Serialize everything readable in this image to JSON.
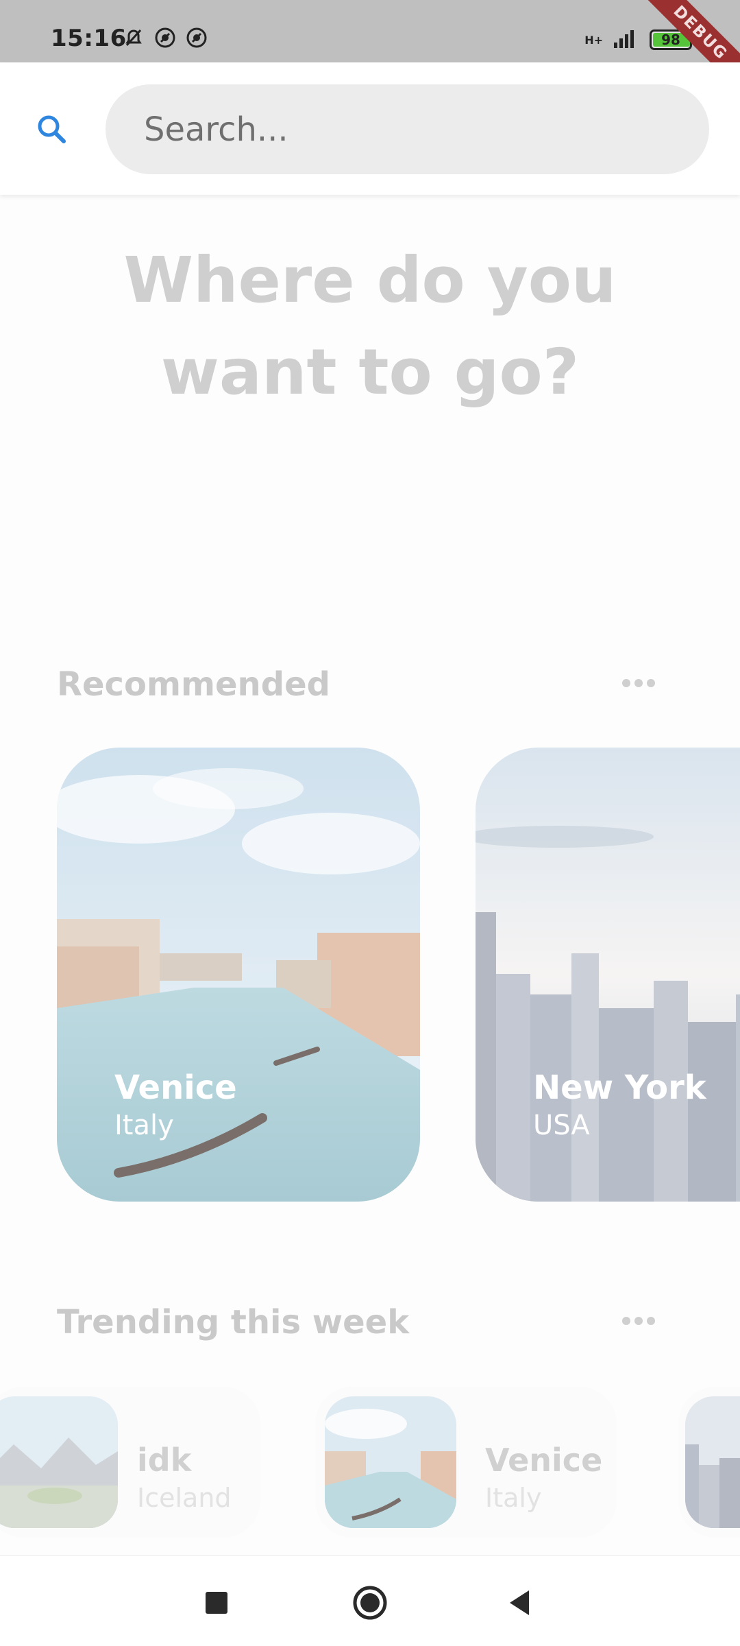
{
  "status_bar": {
    "time": "15:16",
    "network": "H+",
    "battery": "98",
    "debug_banner": "DEBUG"
  },
  "search": {
    "placeholder": "Search...",
    "value": ""
  },
  "headline": {
    "line1": "Where do you",
    "line2": "want to go?"
  },
  "recommended": {
    "title": "Recommended",
    "items": [
      {
        "name": "Venice",
        "country": "Italy"
      },
      {
        "name": "New York",
        "country": "USA"
      }
    ]
  },
  "trending": {
    "title": "Trending this week",
    "items": [
      {
        "name": "idk",
        "country": "Iceland"
      },
      {
        "name": "Venice",
        "country": "Italy"
      },
      {
        "name": "",
        "country": ""
      }
    ]
  },
  "colors": {
    "accent": "#2e86de",
    "status_bar": "#bfbfbf",
    "debug_ribbon": "#9a3030",
    "battery": "#55c43b",
    "muted_text": "#c9c9c9"
  },
  "icons": {
    "search": "search-icon",
    "more": "more-horizontal-icon",
    "nav_recent": "square-icon",
    "nav_home": "circle-icon",
    "nav_back": "triangle-back-icon"
  }
}
